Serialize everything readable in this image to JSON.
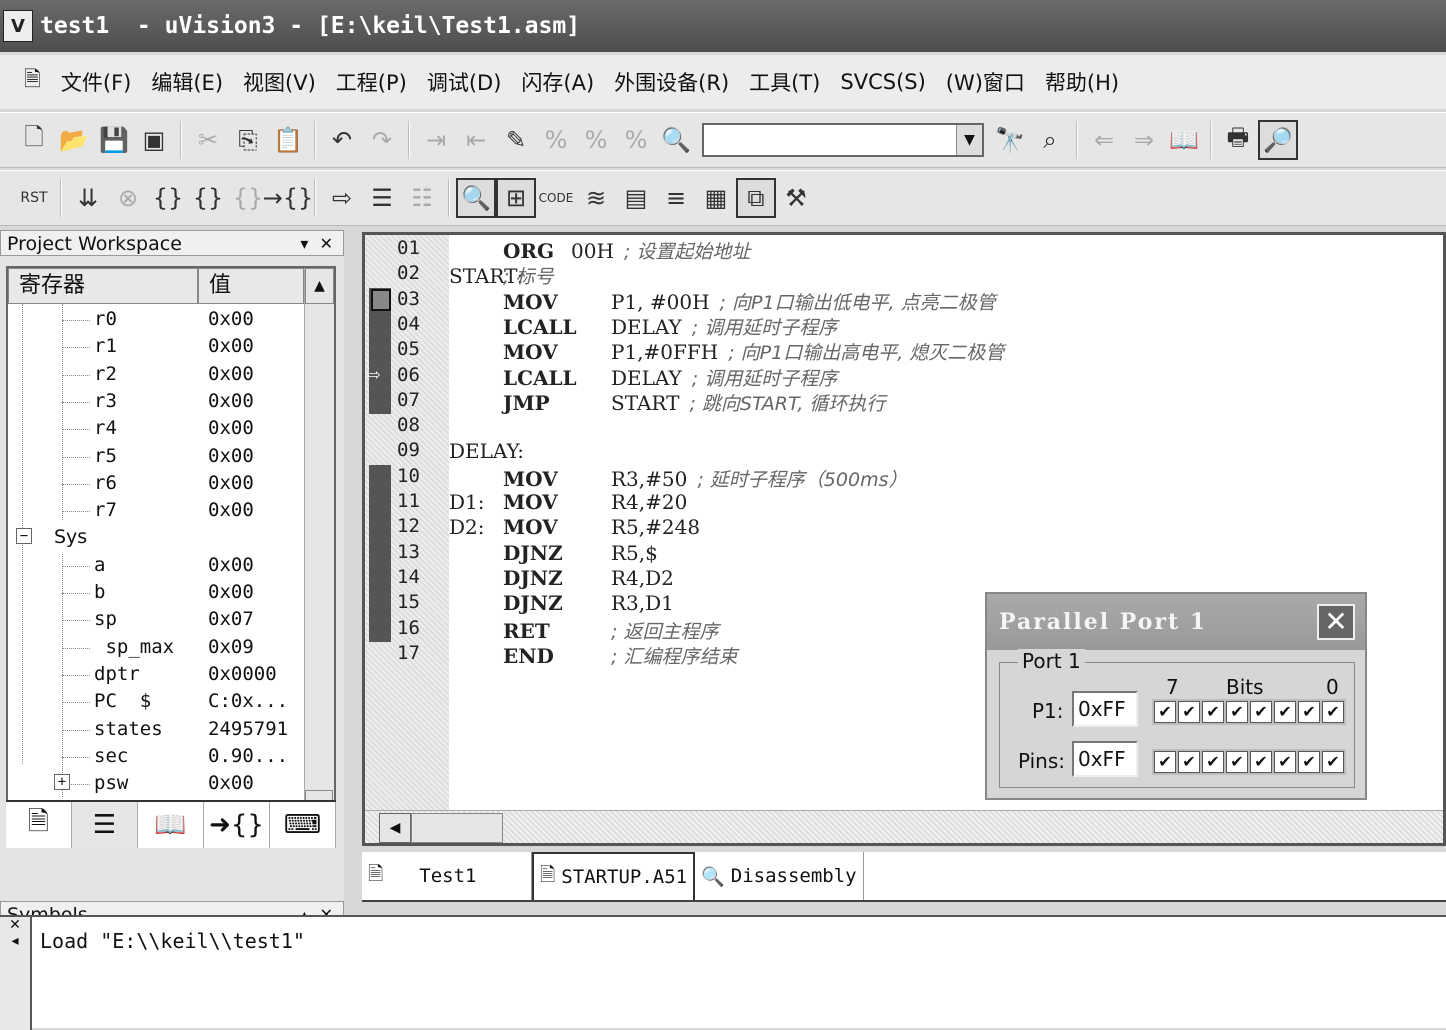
{
  "title": "test1  - uVision3 - [E:\\keil\\Test1.asm]",
  "app_icon": "V",
  "menu": [
    "文件(F)",
    "编辑(E)",
    "视图(V)",
    "工程(P)",
    "调试(D)",
    "闪存(A)",
    "外围设备(R)",
    "工具(T)",
    "SVCS(S)",
    "(W)窗口",
    "帮助(H)"
  ],
  "toolbar1": {
    "find_value": ""
  },
  "workspace": {
    "title": "Project Workspace",
    "col_register": "寄存器",
    "col_value": "值",
    "sys_label": "Sys",
    "registers": [
      {
        "name": "r0",
        "value": "0x00"
      },
      {
        "name": "r1",
        "value": "0x00"
      },
      {
        "name": "r2",
        "value": "0x00"
      },
      {
        "name": "r3",
        "value": "0x00"
      },
      {
        "name": "r4",
        "value": "0x00"
      },
      {
        "name": "r5",
        "value": "0x00"
      },
      {
        "name": "r6",
        "value": "0x00"
      },
      {
        "name": "r7",
        "value": "0x00"
      }
    ],
    "sys": [
      {
        "name": "a",
        "value": "0x00"
      },
      {
        "name": "b",
        "value": "0x00"
      },
      {
        "name": "sp",
        "value": "0x07"
      },
      {
        "name": " sp_max",
        "value": "0x09"
      },
      {
        "name": "dptr",
        "value": "0x0000"
      },
      {
        "name": "PC  $",
        "value": "C:0x..."
      },
      {
        "name": "states",
        "value": "2495791"
      },
      {
        "name": "sec",
        "value": "0.90..."
      },
      {
        "name": "psw",
        "value": "0x00"
      }
    ]
  },
  "symbols": {
    "title": "Symbols"
  },
  "editor": {
    "lines": [
      {
        "n": "01",
        "label": "",
        "op": "ORG",
        "arg": "00H",
        "comment": "; 设置起始地址"
      },
      {
        "n": "02",
        "label": "START:",
        "op": "",
        "arg": "",
        "comment": "; 标号"
      },
      {
        "n": "03",
        "label": "",
        "op": "MOV",
        "arg": "P1, #00H",
        "comment": "; 向P1口输出低电平, 点亮二极管"
      },
      {
        "n": "04",
        "label": "",
        "op": "LCALL",
        "arg": "DELAY",
        "comment": "; 调用延时子程序"
      },
      {
        "n": "05",
        "label": "",
        "op": "MOV",
        "arg": "P1,#0FFH",
        "comment": "; 向P1口输出高电平, 熄灭二极管"
      },
      {
        "n": "06",
        "label": "",
        "op": "LCALL",
        "arg": "DELAY",
        "comment": "; 调用延时子程序"
      },
      {
        "n": "07",
        "label": "",
        "op": "JMP",
        "arg": "START",
        "comment": "; 跳向START, 循环执行"
      },
      {
        "n": "08",
        "label": "",
        "op": "",
        "arg": "",
        "comment": ""
      },
      {
        "n": "09",
        "label": "DELAY:",
        "op": "",
        "arg": "",
        "comment": ""
      },
      {
        "n": "10",
        "label": "",
        "op": "MOV",
        "arg": "R3,#50",
        "comment": "; 延时子程序（500ms）"
      },
      {
        "n": "11",
        "label": "D1:",
        "op": "MOV",
        "arg": "R4,#20",
        "comment": ""
      },
      {
        "n": "12",
        "label": "D2:",
        "op": "MOV",
        "arg": "R5,#248",
        "comment": ""
      },
      {
        "n": "13",
        "label": "",
        "op": "DJNZ",
        "arg": "R5,$",
        "comment": ""
      },
      {
        "n": "14",
        "label": "",
        "op": "DJNZ",
        "arg": "R4,D2",
        "comment": ""
      },
      {
        "n": "15",
        "label": "",
        "op": "DJNZ",
        "arg": "R3,D1",
        "comment": ""
      },
      {
        "n": "16",
        "label": "",
        "op": "RET",
        "arg": "",
        "comment": "; 返回主程序"
      },
      {
        "n": "17",
        "label": "",
        "op": "END",
        "arg": "",
        "comment": "; 汇编程序结束"
      }
    ],
    "current_line": "06"
  },
  "file_tabs": [
    "Test1",
    "STARTUP.A51",
    "Disassembly"
  ],
  "parallel_port": {
    "title": "Parallel Port 1",
    "group": "Port 1",
    "bit_high": "7",
    "bits_label": "Bits",
    "bit_low": "0",
    "p1_label": "P1:",
    "p1_value": "0xFF",
    "pins_label": "Pins:",
    "pins_value": "0xFF",
    "p1_bits": [
      1,
      1,
      1,
      1,
      1,
      1,
      1,
      1
    ],
    "pins_bits": [
      1,
      1,
      1,
      1,
      1,
      1,
      1,
      1
    ]
  },
  "output": {
    "text": "Load \"E:\\\\keil\\\\test1\""
  }
}
